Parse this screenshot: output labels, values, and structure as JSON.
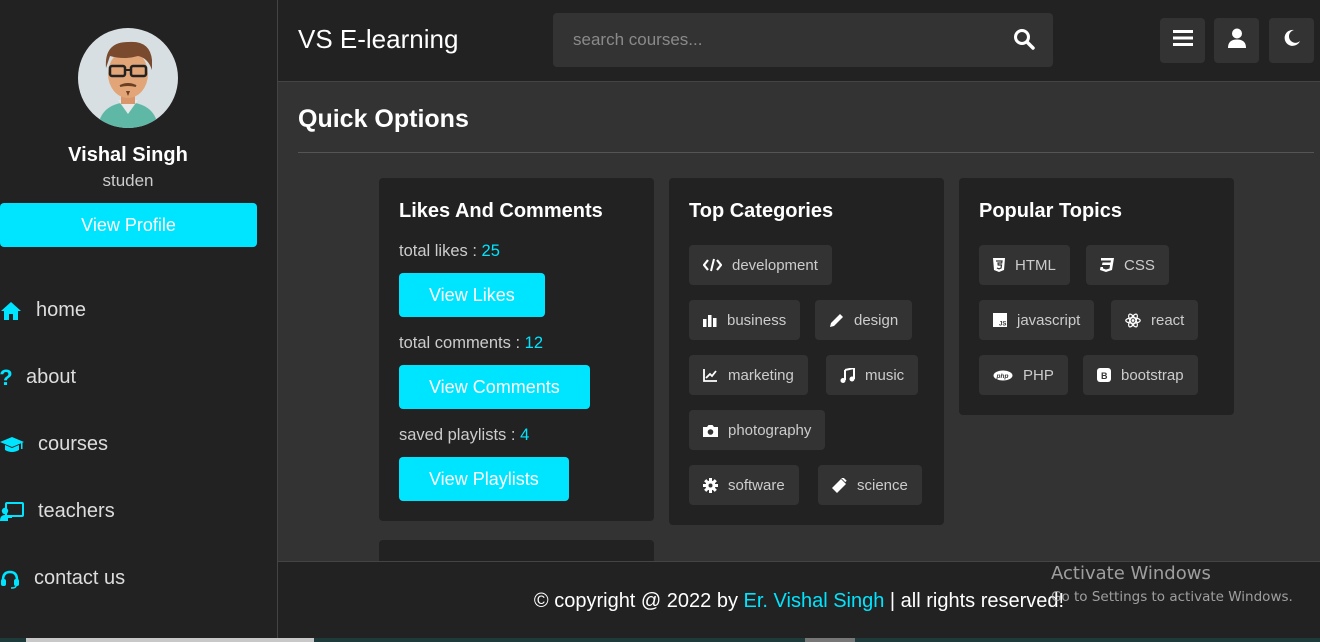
{
  "profile": {
    "name": "Vishal Singh",
    "role": "studen",
    "button": "View Profile"
  },
  "nav": [
    {
      "label": "home",
      "icon": "home-icon"
    },
    {
      "label": "about",
      "icon": "question-icon"
    },
    {
      "label": "courses",
      "icon": "graduation-cap-icon"
    },
    {
      "label": "teachers",
      "icon": "chalkboard-teacher-icon"
    },
    {
      "label": "contact us",
      "icon": "headset-icon"
    }
  ],
  "header": {
    "logo": "VS E-learning",
    "search_placeholder": "search courses..."
  },
  "page": {
    "title": "Quick Options"
  },
  "likes_card": {
    "title": "Likes And Comments",
    "likes_label": "total likes : ",
    "likes_value": "25",
    "likes_button": "View Likes",
    "comments_label": "total comments : ",
    "comments_value": "12",
    "comments_button": "View Comments",
    "playlists_label": "saved playlists : ",
    "playlists_value": "4",
    "playlists_button": "View Playlists"
  },
  "categories_card": {
    "title": "Top Categories",
    "items": [
      "development",
      "business",
      "design",
      "marketing",
      "music",
      "photography",
      "software",
      "science"
    ]
  },
  "topics_card": {
    "title": "Popular Topics",
    "items": [
      "HTML",
      "CSS",
      "javascript",
      "react",
      "PHP",
      "bootstrap"
    ]
  },
  "footer": {
    "prefix": "© copyright @ 2022 by ",
    "author": "Er. Vishal Singh",
    "suffix": " | all rights reserved!"
  },
  "watermark": {
    "line1": "Activate Windows",
    "line2": "Go to Settings to activate Windows."
  },
  "colors": {
    "accent": "#00e5ff",
    "panel": "#222222",
    "background": "#333333"
  }
}
